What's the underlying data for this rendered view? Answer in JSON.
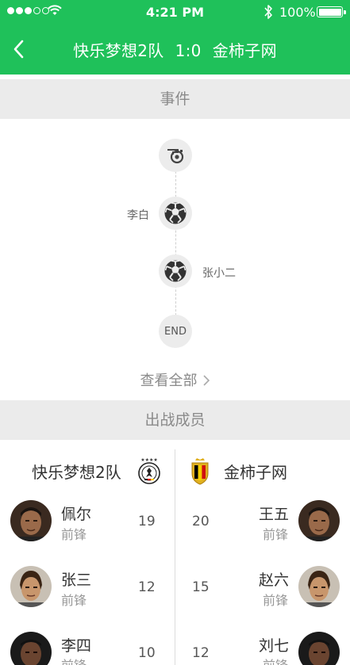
{
  "status_bar": {
    "time": "4:21 PM",
    "battery": "100%"
  },
  "nav": {
    "home_team": "快乐梦想2队",
    "score": "1:0",
    "away_team": "金柿子网"
  },
  "events_section": {
    "title": "事件",
    "events": [
      {
        "type": "whistle",
        "player": ""
      },
      {
        "type": "goal",
        "side": "left",
        "player": "李白"
      },
      {
        "type": "goal",
        "side": "right",
        "player": "张小二"
      },
      {
        "type": "end",
        "label": "END"
      }
    ],
    "view_all": "查看全部"
  },
  "lineup_section": {
    "title": "出战成员",
    "home": {
      "name": "快乐梦想2队",
      "players": [
        {
          "name": "佩尔",
          "position": "前锋",
          "number": "19"
        },
        {
          "name": "张三",
          "position": "前锋",
          "number": "12"
        },
        {
          "name": "李四",
          "position": "前锋",
          "number": "10"
        }
      ]
    },
    "away": {
      "name": "金柿子网",
      "players": [
        {
          "name": "王五",
          "position": "前锋",
          "number": "20"
        },
        {
          "name": "赵六",
          "position": "前锋",
          "number": "15"
        },
        {
          "name": "刘七",
          "position": "前锋",
          "number": "12"
        }
      ]
    }
  },
  "colors": {
    "brand_green": "#1fc15a",
    "section_bg": "#ebebeb"
  }
}
